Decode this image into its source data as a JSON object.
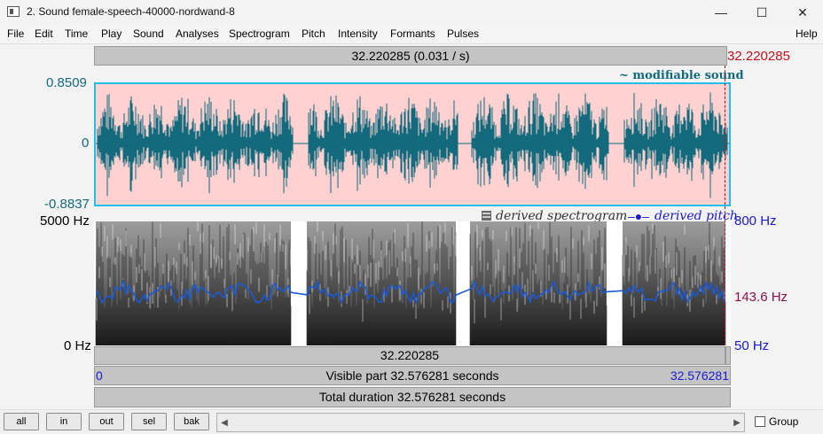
{
  "window": {
    "title": "2. Sound female-speech-40000-nordwand-8",
    "minimize": "—",
    "maximize": "☐",
    "close": "✕"
  },
  "menu": [
    "File",
    "Edit",
    "Time",
    "Play",
    "Sound",
    "Analyses",
    "Spectrogram",
    "Pitch",
    "Intensity",
    "Formants",
    "Pulses",
    "Help"
  ],
  "top_bar": {
    "text": "32.220285 (0.031 / s)",
    "cursor_time": "32.220285"
  },
  "waveform": {
    "label": "~ modifiable sound",
    "y_max": "0.8509",
    "y_zero": "0",
    "y_min": "-0.8837"
  },
  "spectrogram": {
    "legend_spectrogram": "derived spectrogram",
    "legend_pitch": "derived pitch",
    "freq_max": "5000 Hz",
    "freq_min": "0 Hz",
    "pitch_max": "800 Hz",
    "pitch_value": "143.6 Hz",
    "pitch_min": "50 Hz",
    "pitch_color": "#1a5ad8"
  },
  "cursor_bar": {
    "text": "32.220285"
  },
  "visible_bar": {
    "start": "0",
    "text": "Visible part 32.576281 seconds",
    "end": "32.576281"
  },
  "total_bar": {
    "text": "Total duration 32.576281 seconds"
  },
  "buttons": {
    "all": "all",
    "in": "in",
    "out": "out",
    "sel": "sel",
    "bak": "bak"
  },
  "group": {
    "label": "Group",
    "checked": false
  },
  "colors": {
    "wave": "#126a7c",
    "wave_bg": "#ffd1d1",
    "frame": "#20c0e8",
    "cursor": "#c0101a"
  }
}
